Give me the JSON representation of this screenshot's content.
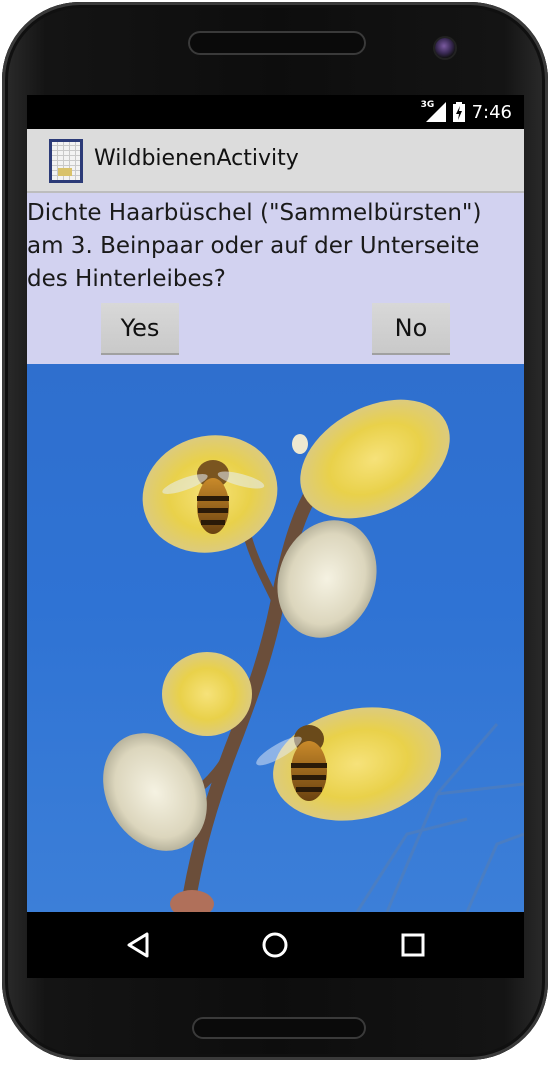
{
  "status_bar": {
    "network": "3G",
    "time": "7:46"
  },
  "app": {
    "title": "WildbienenActivity"
  },
  "question": {
    "text": "Dichte Haarbüschel (\"Sammelbürsten\") am 3. Beinpaar oder auf der Unterseite des Hinterleibes?"
  },
  "buttons": {
    "yes_label": "Yes",
    "no_label": "No"
  },
  "photo": {
    "subject": "bees-on-willow-catkins",
    "sky_color": "#2f71d2"
  },
  "nav": {
    "back_icon": "back-triangle-icon",
    "home_icon": "home-circle-icon",
    "recent_icon": "recent-square-icon"
  },
  "colors": {
    "question_background": "#d2d2f0",
    "action_bar_background": "#dcdcdc",
    "button_background": "#d0d0d0"
  }
}
